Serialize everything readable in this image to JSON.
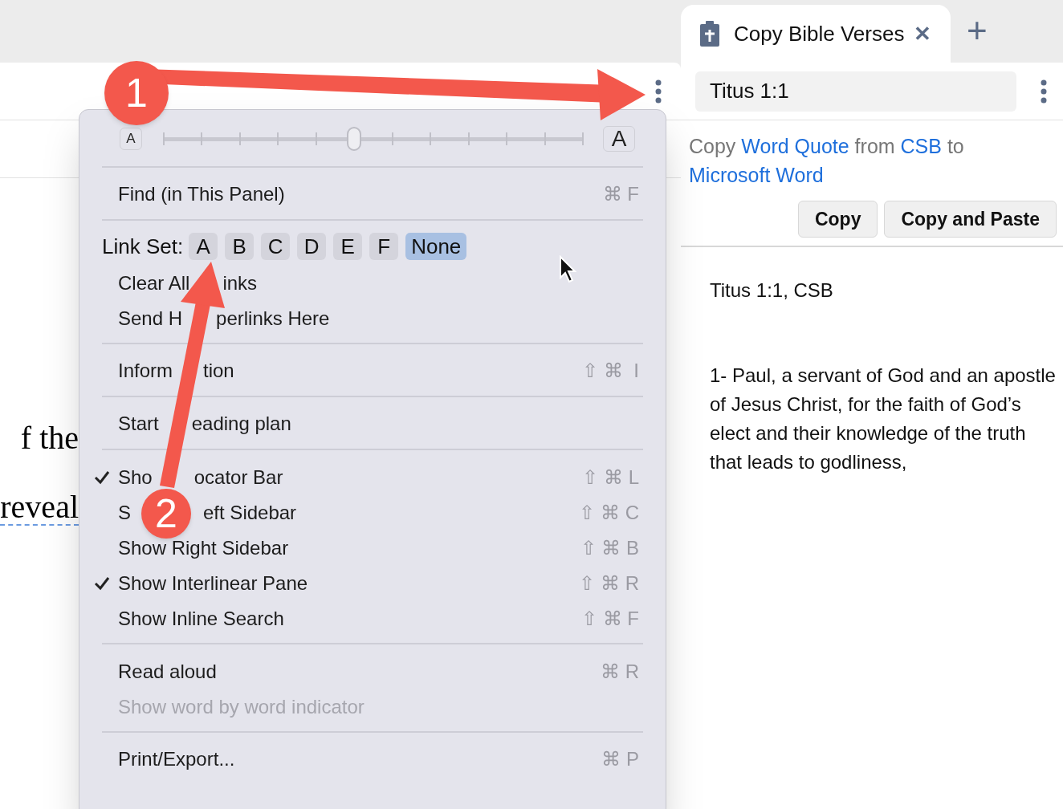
{
  "document": {
    "lines": [
      {
        "text": "f the",
        "underlined": false
      },
      {
        "text": "reveal",
        "underlined": true
      }
    ]
  },
  "menu": {
    "sections": [
      [
        {
          "kind": "slider",
          "small_label": "A",
          "large_label": "A",
          "level": 0.456
        }
      ],
      [
        {
          "kind": "item",
          "label": "Find (in This Panel)",
          "shortcut": "⌘ F",
          "checked": false,
          "disabled": false
        }
      ],
      [
        {
          "kind": "linkset",
          "label": "Link Set:",
          "options": [
            {
              "label": "A",
              "selected": false
            },
            {
              "label": "B",
              "selected": false
            },
            {
              "label": "C",
              "selected": false
            },
            {
              "label": "D",
              "selected": false
            },
            {
              "label": "E",
              "selected": false
            },
            {
              "label": "F",
              "selected": false
            },
            {
              "label": "None",
              "selected": true
            }
          ]
        },
        {
          "kind": "item",
          "label_parts": [
            "Clear All",
            "inks"
          ],
          "checked": false,
          "disabled": false
        },
        {
          "kind": "item",
          "label_parts": [
            "Send H",
            "perlinks Here"
          ],
          "checked": false,
          "disabled": false
        }
      ],
      [
        {
          "kind": "item",
          "label_parts": [
            "Inform",
            "tion"
          ],
          "shortcut": "⇧ ⌘  I",
          "checked": false,
          "disabled": false
        }
      ],
      [
        {
          "kind": "item",
          "label_parts": [
            "Start",
            "eading plan"
          ],
          "checked": false,
          "disabled": false
        }
      ],
      [
        {
          "kind": "item",
          "label_parts": [
            "Sho",
            "ocator Bar"
          ],
          "shortcut": "⇧ ⌘ L",
          "checked": true,
          "disabled": false
        },
        {
          "kind": "item",
          "label_parts": [
            "S",
            "eft Sidebar"
          ],
          "shortcut": "⇧ ⌘ C",
          "checked": false,
          "disabled": false
        },
        {
          "kind": "item",
          "label": "Show Right Sidebar",
          "shortcut": "⇧ ⌘ B",
          "checked": false,
          "disabled": false
        },
        {
          "kind": "item",
          "label": "Show Interlinear Pane",
          "shortcut": "⇧ ⌘ R",
          "checked": true,
          "disabled": false
        },
        {
          "kind": "item",
          "label": "Show Inline Search",
          "shortcut": "⇧ ⌘ F",
          "checked": false,
          "disabled": false
        }
      ],
      [
        {
          "kind": "item",
          "label": "Read aloud",
          "shortcut": "⌘ R",
          "checked": false,
          "disabled": false
        },
        {
          "kind": "item",
          "label": "Show word by word indicator",
          "checked": false,
          "disabled": true
        }
      ],
      [
        {
          "kind": "item",
          "label": "Print/Export...",
          "shortcut": "⌘ P",
          "checked": false,
          "disabled": false
        }
      ]
    ]
  },
  "right_panel": {
    "tab": {
      "title": "Copy Bible Verses",
      "close": "✕",
      "add": "+"
    },
    "locator": {
      "value": "Titus 1:1"
    },
    "sentence": [
      {
        "text": "Copy",
        "link": false
      },
      {
        "text": "Word Quote",
        "link": true
      },
      {
        "text": "from",
        "link": false
      },
      {
        "text": "CSB",
        "link": true
      },
      {
        "text": "to",
        "link": false
      },
      {
        "text": "Microsoft Word",
        "link": true
      }
    ],
    "buttons": [
      "Copy",
      "Copy and Paste"
    ],
    "reference": "Titus 1:1, CSB",
    "verse": "1- Paul, a servant of God and an apostle of Jesus Christ, for the faith of God’s elect and their knowledge of the truth that leads to godliness,"
  },
  "annotations": [
    {
      "number": "1"
    },
    {
      "number": "2"
    }
  ]
}
